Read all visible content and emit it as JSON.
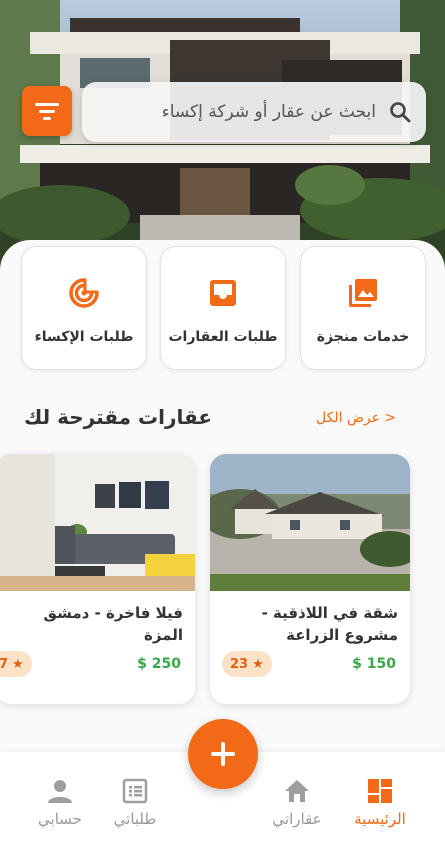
{
  "search": {
    "placeholder": "ابحث عن عقار أو شركة إكساء"
  },
  "categories": [
    {
      "label": "خدمات منجزة",
      "icon": "photo-library-icon"
    },
    {
      "label": "طلبات العقارات",
      "icon": "inbox-icon"
    },
    {
      "label": "طلبات الإكساء",
      "icon": "target-icon"
    }
  ],
  "section": {
    "title": "عقارات مقترحة لك",
    "see_all": "< عرض الكل"
  },
  "properties": [
    {
      "name": "شقة في اللاذقية - مشروع الزراعة",
      "price": "$ 150",
      "rating": "23"
    },
    {
      "name": "فيلا فاخرة - دمشق المزة",
      "price": "$ 250",
      "rating": "7"
    }
  ],
  "nav": {
    "home": "الرئيسية",
    "my_properties": "عقاراتي",
    "my_requests": "طلباتي",
    "account": "حسابي"
  },
  "colors": {
    "accent": "#f26a17",
    "price": "#3aa84a"
  }
}
